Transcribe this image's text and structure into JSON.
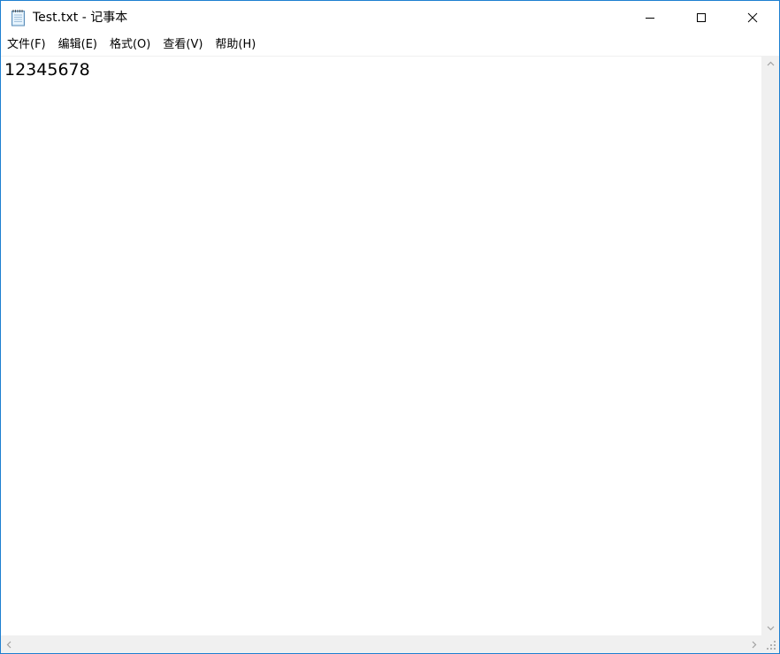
{
  "window": {
    "title": "Test.txt - 记事本",
    "border_color": "#1e7fd0"
  },
  "icons": {
    "app": "notepad-icon",
    "minimize": "minimize-icon",
    "maximize": "maximize-icon",
    "close": "close-icon",
    "scroll_up": "chevron-up-icon",
    "scroll_down": "chevron-down-icon",
    "scroll_left": "chevron-left-icon",
    "scroll_right": "chevron-right-icon",
    "grip": "size-grip-icon"
  },
  "menu": {
    "items": [
      {
        "label": "文件(F)"
      },
      {
        "label": "编辑(E)"
      },
      {
        "label": "格式(O)"
      },
      {
        "label": "查看(V)"
      },
      {
        "label": "帮助(H)"
      }
    ]
  },
  "editor": {
    "content": "12345678"
  }
}
